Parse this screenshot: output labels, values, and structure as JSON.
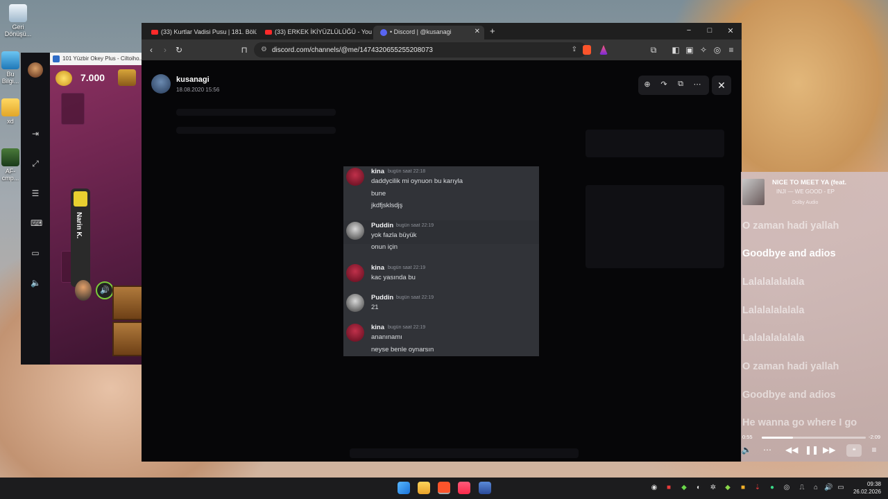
{
  "desktop": {
    "icons": [
      {
        "label": "Geri Dönüşü...",
        "icon": "recycle-bin-icon"
      },
      {
        "label": "Bu Bilgi...",
        "icon": "computer-icon"
      },
      {
        "label": "xd",
        "icon": "folder-icon"
      },
      {
        "label": "AF-cmp...",
        "icon": "video-file-icon"
      }
    ]
  },
  "game": {
    "window_title": "101 Yüzbir Okey Plus - Ciltoiho...",
    "coins": "7.000",
    "player_name": "Narin K.",
    "side_icons": [
      "exit-icon",
      "fullscreen-icon",
      "settings-sliders-icon",
      "keyboard-icon",
      "label-icon",
      "volume-icon"
    ]
  },
  "browser": {
    "tabs": [
      {
        "title": "(33) Kurtlar Vadisi Pusu | 181. Bölüm",
        "icon": "youtube-icon",
        "active": false
      },
      {
        "title": "(33) ERKEK İKİYÜZLÜLÜĞÜ - YouTube",
        "icon": "youtube-icon",
        "active": false
      },
      {
        "title": "• Discord | @kusanagi",
        "icon": "discord-icon",
        "active": true
      }
    ],
    "new_tab": "+",
    "window_controls": [
      "−",
      "□",
      "✕"
    ],
    "url": "discord.com/channels/@me/1474320655255208073"
  },
  "viewer": {
    "user_name": "kusanagi",
    "date": "18.08.2020 15:56",
    "tools": [
      "zoom-in-icon",
      "forward-icon",
      "open-external-icon",
      "more-icon"
    ],
    "close": "✕"
  },
  "chat": {
    "messages": [
      {
        "author": "kina",
        "avatar": "kina",
        "time": "bugün saat 22:18",
        "lines": [
          "daddycilik mi oynuon bu karıyla",
          "bune",
          "jkdfjsklsdjş"
        ]
      },
      {
        "author": "Puddin",
        "avatar": "puddin",
        "time": "bugün saat 22:19",
        "lines": [
          "yok fazla büyük",
          "onun için"
        ]
      },
      {
        "author": "kina",
        "avatar": "kina",
        "time": "bugün saat 22:19",
        "lines": [
          "kac yasında bu"
        ]
      },
      {
        "author": "Puddin",
        "avatar": "puddin",
        "time": "bugün saat 22:19",
        "lines": [
          "21"
        ]
      },
      {
        "author": "kina",
        "avatar": "kina",
        "time": "bugün saat 22:19",
        "lines": [
          "ananınamı",
          "neyse benle oynarsın"
        ]
      }
    ]
  },
  "music": {
    "title": "NICE TO MEET YA (feat.",
    "artist": "INJI — WE GOOD - EP",
    "badge": "Dolby Audio",
    "lyrics": [
      "O zaman hadi yallah",
      "Goodbye and adios",
      "Lalalalalalala",
      "Lalalalalalala",
      "Lalalalalalala",
      "O zaman hadi yallah",
      "Goodbye and adios",
      "He wanna go where I go"
    ],
    "current_lyric_index": 1,
    "elapsed": "0:55",
    "remaining": "-2:09",
    "progress": 0.3,
    "controls": [
      "volume-icon",
      "more-icon",
      "rewind-icon",
      "pause-icon",
      "fast-forward-icon",
      "lyrics-icon",
      "queue-icon"
    ]
  },
  "taskbar": {
    "apps": [
      "windows-start-icon",
      "file-explorer-icon",
      "brave-browser-icon",
      "apple-music-icon",
      "okey-game-icon"
    ],
    "time": "09:38",
    "date": "26.02.2026"
  }
}
